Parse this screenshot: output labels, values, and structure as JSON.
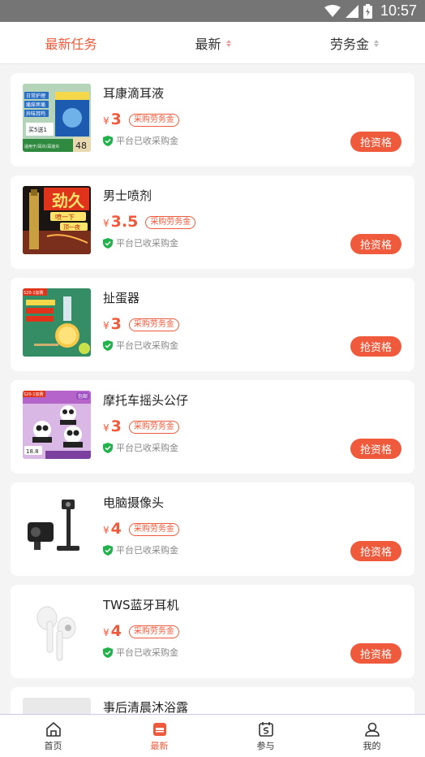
{
  "status_bar": {
    "time": "10:57"
  },
  "filters": [
    {
      "label": "最新任务"
    },
    {
      "label": "最新"
    },
    {
      "label": "劳务金"
    }
  ],
  "products": [
    {
      "name": "耳康滴耳液",
      "price": "3",
      "tag": "采购劳务金",
      "platform_text": "平台已收采购金",
      "button": "抢资格"
    },
    {
      "name": "男士喷剂",
      "price": "3.5",
      "tag": "采购劳务金",
      "platform_text": "平台已收采购金",
      "button": "抢资格"
    },
    {
      "name": "扯蛋器",
      "price": "3",
      "tag": "采购劳务金",
      "platform_text": "平台已收采购金",
      "button": "抢资格"
    },
    {
      "name": "摩托车摇头公仔",
      "price": "3",
      "tag": "采购劳务金",
      "platform_text": "平台已收采购金",
      "button": "抢资格"
    },
    {
      "name": "电脑摄像头",
      "price": "4",
      "tag": "采购劳务金",
      "platform_text": "平台已收采购金",
      "button": "抢资格"
    },
    {
      "name": "TWS蓝牙耳机",
      "price": "4",
      "tag": "采购劳务金",
      "platform_text": "平台已收采购金",
      "button": "抢资格"
    },
    {
      "name": "事后清晨沐浴露"
    }
  ],
  "currency_symbol": "¥",
  "thumb_text": {
    "p1_a": "日常护理",
    "p1_b": "痛痒疼痛",
    "p1_c": "异味耳鸣",
    "p1_d": "买5送1",
    "p1_e": "适用于/耳炎/耳道炎",
    "p1_f": "48",
    "p2_a": "劲久",
    "p2_b": "喷一下",
    "p2_c": "顶一夜",
    "p3_a": "S20-1加赛",
    "p4_a": "S20-1加赛",
    "p4_b": "包邮",
    "p4_c": "18.8"
  },
  "tabbar": [
    {
      "label": "首页",
      "icon": "home-icon"
    },
    {
      "label": "最新",
      "icon": "new-icon"
    },
    {
      "label": "参与",
      "icon": "calendar-icon"
    },
    {
      "label": "我的",
      "icon": "user-icon"
    }
  ],
  "colors": {
    "accent": "#f05a3c",
    "status_bar": "#757575",
    "background": "#f4f4f4"
  }
}
